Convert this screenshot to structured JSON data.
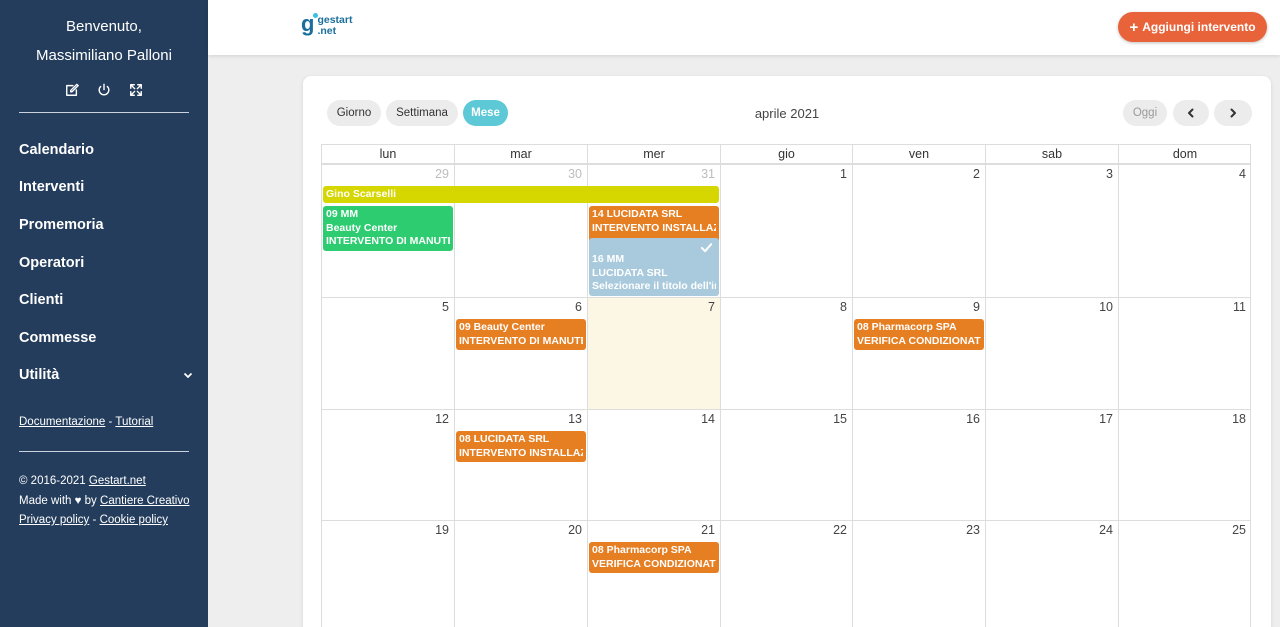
{
  "sidebar": {
    "welcome_line1": "Benvenuto,",
    "welcome_line2": "Massimiliano Palloni",
    "tools": [
      {
        "icon": "edit-icon",
        "name": "edit-profile-button"
      },
      {
        "icon": "power-icon",
        "name": "logout-button"
      },
      {
        "icon": "expand-icon",
        "name": "fullscreen-button"
      }
    ],
    "nav": [
      {
        "label": "Calendario",
        "key": "calendario"
      },
      {
        "label": "Interventi",
        "key": "interventi"
      },
      {
        "label": "Promemoria",
        "key": "promemoria"
      },
      {
        "label": "Operatori",
        "key": "operatori"
      },
      {
        "label": "Clienti",
        "key": "clienti"
      },
      {
        "label": "Commesse",
        "key": "commesse"
      },
      {
        "label": "Utilità",
        "key": "utilita",
        "icon": "chevron-down-icon"
      }
    ],
    "links": {
      "documentation": "Documentazione",
      "separator": "-",
      "tutorial": "Tutorial"
    },
    "footer": {
      "copyright": "© 2016-2021",
      "company_link": "Gestart.net",
      "made_with": "Made with",
      "heart": "♥",
      "by": "by",
      "author_link": "Cantiere Creativo",
      "privacy": "Privacy policy",
      "separator": "-",
      "cookie": "Cookie policy"
    }
  },
  "topbar": {
    "logo": {
      "mark": "g",
      "line1": "gestart",
      "line2": ".net"
    },
    "add_button": {
      "icon": "+",
      "label": "Aggiungi intervento"
    }
  },
  "calendar": {
    "title": "aprile 2021",
    "view_buttons": [
      {
        "label": "Giorno",
        "active": false
      },
      {
        "label": "Settimana",
        "active": false
      },
      {
        "label": "Mese",
        "active": true
      }
    ],
    "today_button": "Oggi",
    "prev_icon": "chevron-left-icon",
    "next_icon": "chevron-right-icon",
    "weekdays": [
      "lun",
      "mar",
      "mer",
      "gio",
      "ven",
      "sab",
      "dom"
    ],
    "weeks": [
      [
        {
          "day": "29",
          "other": true
        },
        {
          "day": "30",
          "other": true
        },
        {
          "day": "31",
          "other": true
        },
        {
          "day": "1"
        },
        {
          "day": "2"
        },
        {
          "day": "3"
        },
        {
          "day": "4"
        }
      ],
      [
        {
          "day": "5"
        },
        {
          "day": "6"
        },
        {
          "day": "7",
          "today": true
        },
        {
          "day": "8"
        },
        {
          "day": "9"
        },
        {
          "day": "10"
        },
        {
          "day": "11"
        }
      ],
      [
        {
          "day": "12"
        },
        {
          "day": "13"
        },
        {
          "day": "14"
        },
        {
          "day": "15"
        },
        {
          "day": "16"
        },
        {
          "day": "17"
        },
        {
          "day": "18"
        }
      ],
      [
        {
          "day": "19"
        },
        {
          "day": "20"
        },
        {
          "day": "21"
        },
        {
          "day": "22"
        },
        {
          "day": "23"
        },
        {
          "day": "24"
        },
        {
          "day": "25"
        }
      ]
    ],
    "events": [
      {
        "week": 0,
        "col": 0,
        "span": 3,
        "slot": 0,
        "color": "#d6d600",
        "lines": [
          "Gino Scarselli"
        ]
      },
      {
        "week": 0,
        "col": 0,
        "span": 1,
        "slot": 1,
        "color": "#2ecc71",
        "lines": [
          "09 MM",
          "Beauty Center",
          "INTERVENTO DI MANUTENZIONE"
        ]
      },
      {
        "week": 0,
        "col": 2,
        "span": 1,
        "slot": 1,
        "color": "#e67e22",
        "lines": [
          "14 LUCIDATA SRL",
          "INTERVENTO INSTALLAZIONE"
        ]
      },
      {
        "week": 0,
        "col": 2,
        "span": 1,
        "slot": 2,
        "color": "#a9cadc",
        "checked": true,
        "lines": [
          "16 MM",
          "LUCIDATA SRL",
          "Selezionare il titolo dell'intervento"
        ]
      },
      {
        "week": 1,
        "col": 1,
        "span": 1,
        "slot": 0,
        "color": "#e67e22",
        "lines": [
          "09 Beauty Center",
          "INTERVENTO DI MANUTENZIONE"
        ]
      },
      {
        "week": 1,
        "col": 4,
        "span": 1,
        "slot": 0,
        "color": "#e67e22",
        "lines": [
          "08 Pharmacorp SPA",
          "VERIFICA CONDIZIONATORE"
        ]
      },
      {
        "week": 2,
        "col": 1,
        "span": 1,
        "slot": 0,
        "color": "#e67e22",
        "lines": [
          "08 LUCIDATA SRL",
          "INTERVENTO INSTALLAZIONE"
        ]
      },
      {
        "week": 3,
        "col": 2,
        "span": 1,
        "slot": 0,
        "color": "#e67e22",
        "lines": [
          "08 Pharmacorp SPA",
          "VERIFICA CONDIZIONATORE"
        ]
      }
    ]
  }
}
